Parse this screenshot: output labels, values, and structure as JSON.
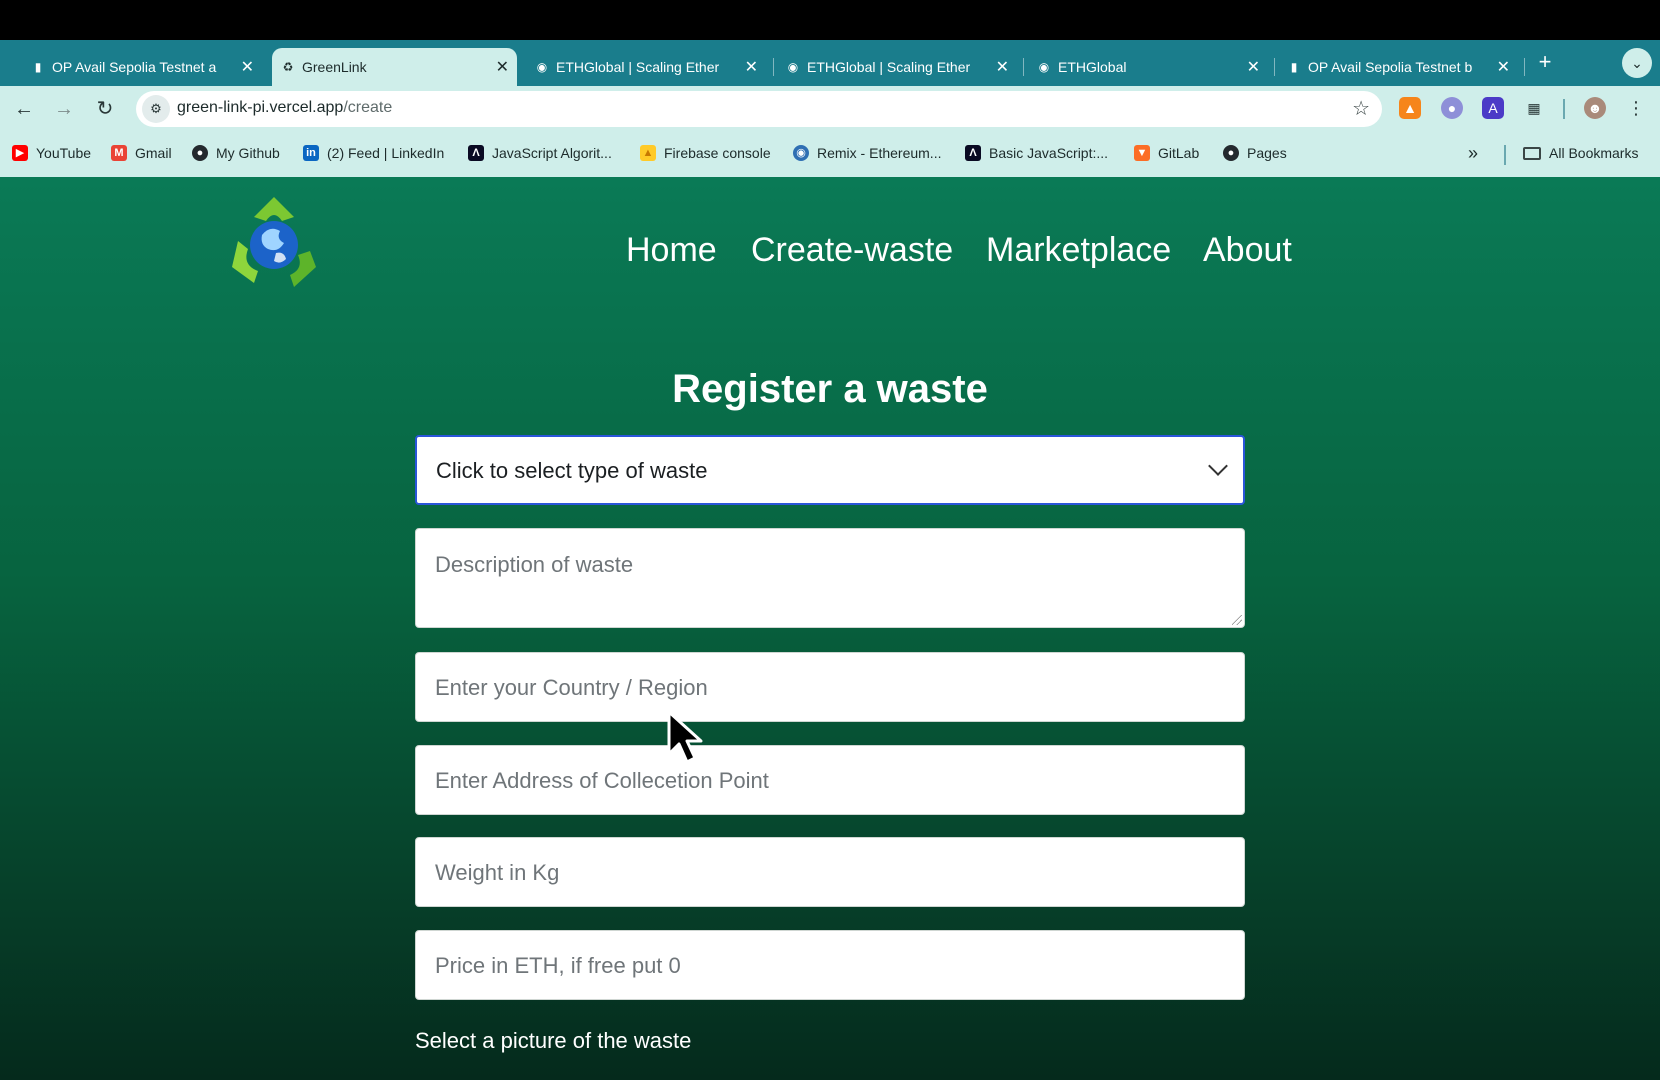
{
  "browser": {
    "tabs": [
      {
        "title": "OP Avail Sepolia Testnet a",
        "icon": "bar-chart-icon",
        "active": false
      },
      {
        "title": "GreenLink",
        "icon": "recycle-icon",
        "active": true
      },
      {
        "title": "ETHGlobal | Scaling Ether",
        "icon": "ethglobal-icon",
        "active": false
      },
      {
        "title": "ETHGlobal | Scaling Ether",
        "icon": "ethglobal-icon",
        "active": false
      },
      {
        "title": "ETHGlobal",
        "icon": "ethglobal-icon",
        "active": false
      },
      {
        "title": "OP Avail Sepolia Testnet b",
        "icon": "bar-chart-icon",
        "active": false
      }
    ],
    "url_host": "green-link-pi.vercel.app",
    "url_path": "/create",
    "bookmarks": [
      {
        "label": "YouTube",
        "icon": "youtube-icon",
        "color": "#ff0000"
      },
      {
        "label": "Gmail",
        "icon": "gmail-icon",
        "color": "#ea4335"
      },
      {
        "label": "My Github",
        "icon": "github-icon",
        "color": "#24292e"
      },
      {
        "label": "(2) Feed | LinkedIn",
        "icon": "linkedin-icon",
        "color": "#0a66c2"
      },
      {
        "label": "JavaScript Algorit...",
        "icon": "freecodecamp-icon",
        "color": "#0a0a23"
      },
      {
        "label": "Firebase console",
        "icon": "firebase-icon",
        "color": "#ffca28"
      },
      {
        "label": "Remix - Ethereum...",
        "icon": "remix-icon",
        "color": "#2f6fb3"
      },
      {
        "label": "Basic JavaScript:...",
        "icon": "freecodecamp-icon",
        "color": "#0a0a23"
      },
      {
        "label": "GitLab",
        "icon": "gitlab-icon",
        "color": "#fc6d26"
      },
      {
        "label": "Pages",
        "icon": "github-icon",
        "color": "#24292e"
      }
    ],
    "all_bookmarks": "All Bookmarks"
  },
  "site": {
    "nav": [
      "Home",
      "Create-waste",
      "Marketplace",
      "About"
    ]
  },
  "form": {
    "heading": "Register a waste",
    "type_select": "Click to select type of waste",
    "description_placeholder": "Description of waste",
    "country_placeholder": "Enter your Country / Region",
    "address_placeholder": "Enter Address of Collecetion Point",
    "weight_placeholder": "Weight in Kg",
    "price_placeholder": "Price in ETH, if free put 0",
    "picture_label": "Select a picture of the waste"
  },
  "colors": {
    "page_top": "#0a7a56",
    "page_bottom": "#052a1c",
    "tabstrip": "#1a7d8c",
    "toolbar": "#cfeeea",
    "select_focus": "#2a55d9"
  }
}
